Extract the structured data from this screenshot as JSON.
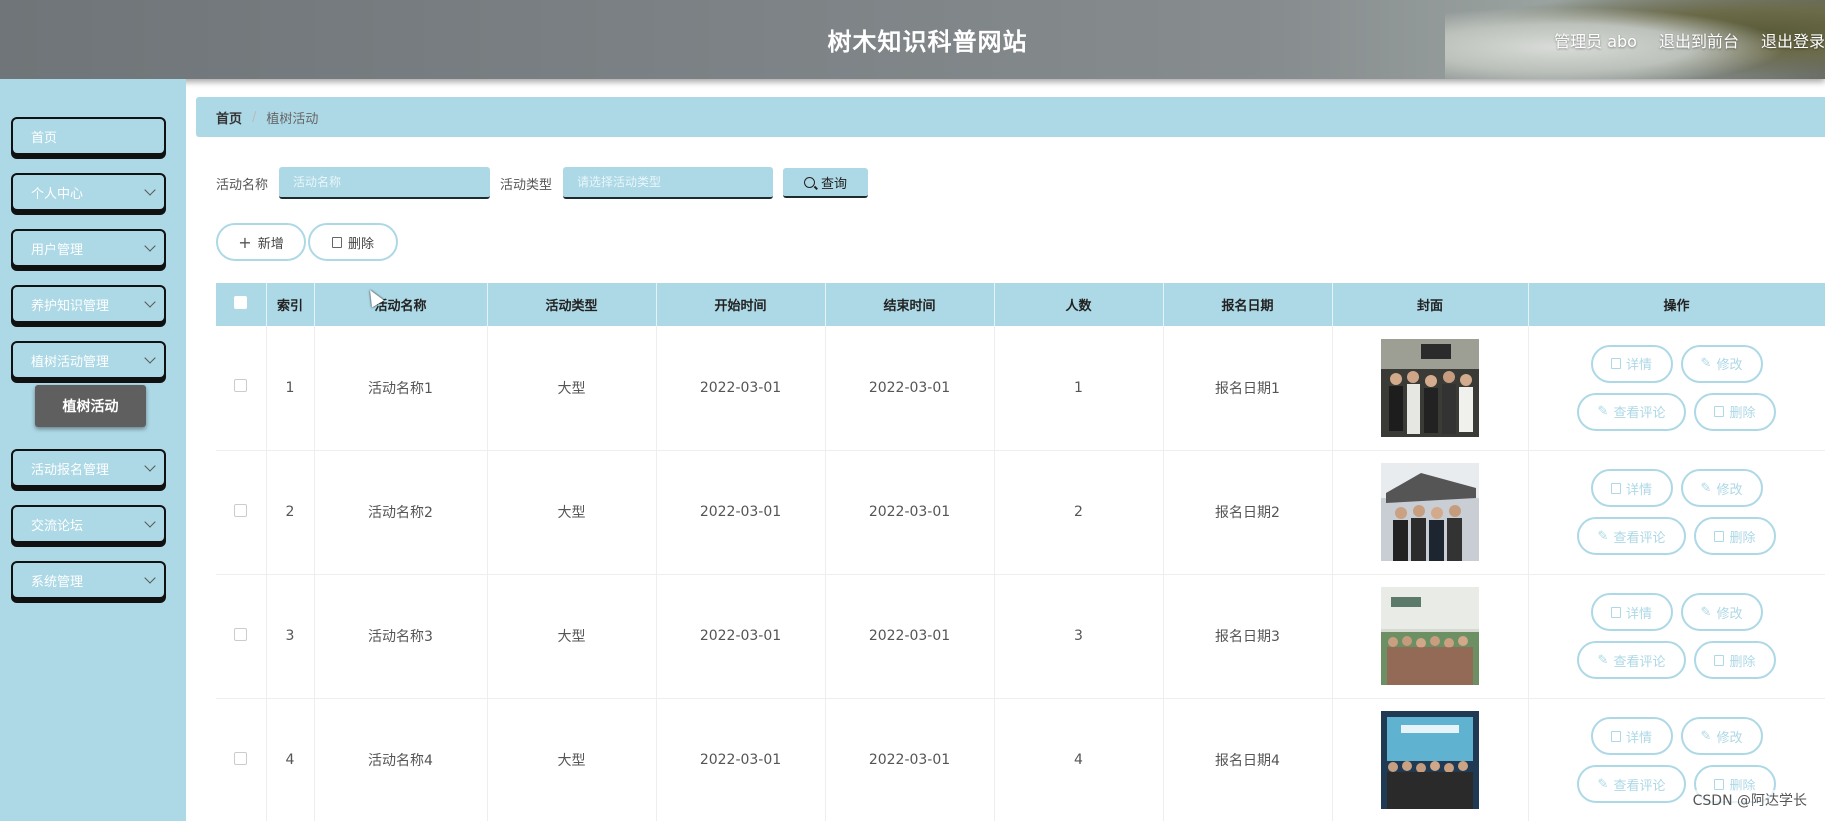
{
  "header": {
    "title": "树木知识科普网站",
    "user_label": "管理员 abo",
    "to_front": "退出到前台",
    "logout": "退出登录"
  },
  "sidebar": {
    "items": [
      {
        "label": "首页",
        "has_chevron": false
      },
      {
        "label": "个人中心",
        "has_chevron": true
      },
      {
        "label": "用户管理",
        "has_chevron": true
      },
      {
        "label": "养护知识管理",
        "has_chevron": true
      },
      {
        "label": "植树活动管理",
        "has_chevron": true
      },
      {
        "label": "活动报名管理",
        "has_chevron": true
      },
      {
        "label": "交流论坛",
        "has_chevron": true
      },
      {
        "label": "系统管理",
        "has_chevron": true
      }
    ],
    "active_sub": "植树活动"
  },
  "breadcrumb": {
    "home": "首页",
    "separator": "/",
    "current": "植树活动"
  },
  "search": {
    "name_label": "活动名称",
    "name_placeholder": "活动名称",
    "type_label": "活动类型",
    "type_placeholder": "请选择活动类型",
    "query_btn": "查询"
  },
  "toolbar": {
    "add": "新增",
    "delete": "删除"
  },
  "table": {
    "headers": [
      "索引",
      "活动名称",
      "活动类型",
      "开始时间",
      "结束时间",
      "人数",
      "报名日期",
      "封面",
      "操作"
    ],
    "rows": [
      {
        "index": "1",
        "name": "活动名称1",
        "type": "大型",
        "start": "2022-03-01",
        "end": "2022-03-01",
        "count": "1",
        "date": "报名日期1"
      },
      {
        "index": "2",
        "name": "活动名称2",
        "type": "大型",
        "start": "2022-03-01",
        "end": "2022-03-01",
        "count": "2",
        "date": "报名日期2"
      },
      {
        "index": "3",
        "name": "活动名称3",
        "type": "大型",
        "start": "2022-03-01",
        "end": "2022-03-01",
        "count": "3",
        "date": "报名日期3"
      },
      {
        "index": "4",
        "name": "活动名称4",
        "type": "大型",
        "start": "2022-03-01",
        "end": "2022-03-01",
        "count": "4",
        "date": "报名日期4"
      }
    ],
    "ops": {
      "detail": "详情",
      "edit": "修改",
      "comments": "查看评论",
      "delete": "删除"
    }
  },
  "watermark": "CSDN @阿达学长",
  "colors": {
    "accent": "#add8e6",
    "submenu": "#5f5f5f"
  }
}
